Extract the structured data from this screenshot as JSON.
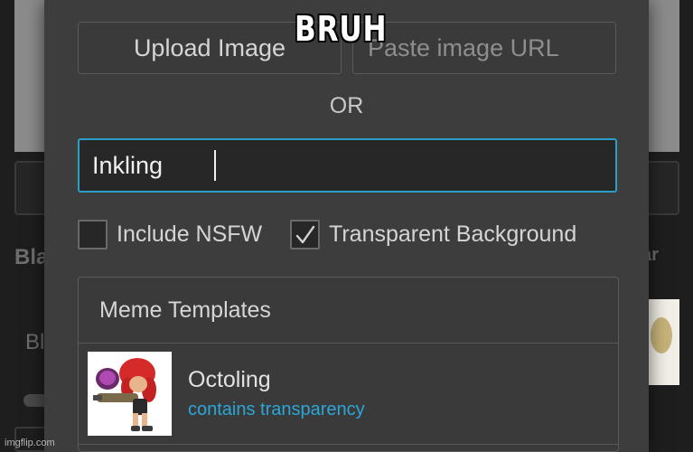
{
  "background": {
    "left_text_1": "Bla",
    "left_text_2": "Bl",
    "right_text": "ar"
  },
  "upload": {
    "upload_label": "Upload Image",
    "url_placeholder": "Paste image URL"
  },
  "or_label": "OR",
  "search": {
    "value": "Inkling"
  },
  "options": {
    "nsfw_label": "Include NSFW",
    "nsfw_checked": false,
    "transparent_label": "Transparent Background",
    "transparent_checked": true
  },
  "templates": {
    "header": "Meme Templates",
    "items": [
      {
        "name": "Octoling",
        "subtitle": "contains transparency"
      }
    ]
  },
  "caption": "BRUH",
  "watermark": "imgflip.com",
  "colors": {
    "accent": "#2aa0c8",
    "link": "#2ba6d8",
    "modal_bg": "#3d3d3d"
  }
}
